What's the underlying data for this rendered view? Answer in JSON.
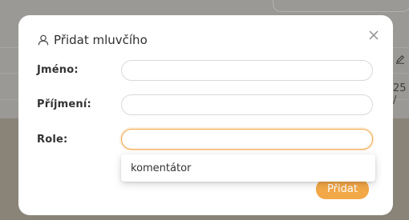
{
  "background": {
    "edge_text": "25 /"
  },
  "dialog": {
    "title": "Přidat mluvčího",
    "close_symbol": "×",
    "fields": [
      {
        "label": "Jméno:",
        "value": "",
        "placeholder": ""
      },
      {
        "label": "Příjmení:",
        "value": "",
        "placeholder": ""
      },
      {
        "label": "Role:",
        "value": "",
        "placeholder": ""
      }
    ],
    "role_options": [
      "komentátor"
    ],
    "submit_label": "Přidat"
  },
  "colors": {
    "accent": "#f3a847",
    "focus_border": "#f0a546",
    "overlay": "#8d8880"
  },
  "icons": {
    "title": "user-icon",
    "close": "close-icon",
    "background_edit": "pencil-icon"
  }
}
